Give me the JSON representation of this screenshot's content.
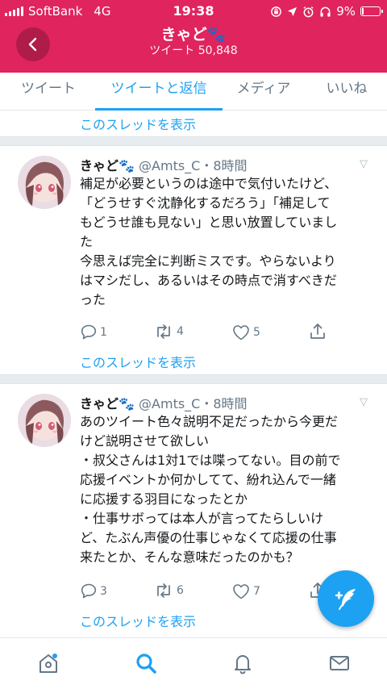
{
  "status_bar": {
    "carrier": "SoftBank",
    "network": "4G",
    "time": "19:38",
    "battery": "9%",
    "battery_level": 0.09
  },
  "header": {
    "title": "きゃど🐾",
    "subtitle": "ツイート 50,848"
  },
  "tabs": [
    {
      "label": "ツイート"
    },
    {
      "label": "ツイートと返信"
    },
    {
      "label": "メディア"
    },
    {
      "label": "いいね"
    }
  ],
  "show_thread_label": "このスレッドを表示",
  "tweets": [
    {
      "name": "きゃど🐾",
      "handle": "@Amts_C",
      "time": "8時間",
      "lines": [
        "補足が必要というのは途中で気付いたけど、",
        "「どうせすぐ沈静化するだろう」「補足して",
        "もどうせ誰も見ない」と思い放置していまし",
        "た",
        "今思えば完全に判断ミスです。やらないより",
        "はマシだし、あるいはその時点で消すべきだ",
        "った"
      ],
      "replies": "1",
      "retweets": "4",
      "likes": "5"
    },
    {
      "name": "きゃど🐾",
      "handle": "@Amts_C",
      "time": "8時間",
      "lines": [
        "あのツイート色々説明不足だったから今更だ",
        "けど説明させて欲しい",
        "・叔父さんは1対1では喋ってない。目の前で",
        "応援イベントか何かしてて、紛れ込んで一緒",
        "に応援する羽目になったとか",
        "・仕事サボっては本人が言ってたらしいけ",
        "ど、たぶん声優の仕事じゃなくて応援の仕事",
        "来たとか、そんな意味だったのかも？"
      ],
      "replies": "3",
      "retweets": "6",
      "likes": "7"
    }
  ],
  "colors": {
    "header": "#e0245e",
    "accent": "#1da1f2",
    "secondary_text": "#657786"
  }
}
